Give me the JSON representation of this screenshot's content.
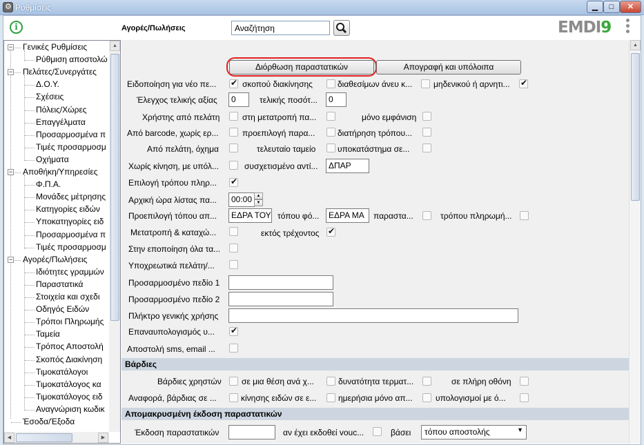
{
  "window": {
    "title": "Ρυθμίσεις",
    "min": "▁",
    "max": "□",
    "close": "✕"
  },
  "toolbar": {
    "section_title": "Αγορές/Πωλήσεις",
    "search_value": "Αναζήτηση",
    "logo_main": "EMDI",
    "logo_accent": "9",
    "info_glyph": "i"
  },
  "tree": {
    "items": [
      {
        "label": "Γενικές Ρυθμίσεις"
      },
      {
        "label": "Ρύθμιση αποστολώ"
      },
      {
        "label": "Πελάτες/Συνεργάτες"
      },
      {
        "label": "Δ.Ο.Υ."
      },
      {
        "label": "Σχέσεις"
      },
      {
        "label": "Πόλεις/Χώρες"
      },
      {
        "label": "Επαγγέλματα"
      },
      {
        "label": "Προσαρμοσμένα π"
      },
      {
        "label": "Τιμές προσαρμοσμ"
      },
      {
        "label": "Οχήματα"
      },
      {
        "label": "Αποθήκη/Υπηρεσίες"
      },
      {
        "label": "Φ.Π.Α."
      },
      {
        "label": "Μονάδες μέτρησης"
      },
      {
        "label": "Κατηγορίες ειδών"
      },
      {
        "label": "Υποκατηγορίες ειδ"
      },
      {
        "label": "Προσαρμοσμένα π"
      },
      {
        "label": "Τιμές προσαρμοσμ"
      },
      {
        "label": "Αγορές/Πωλήσεις"
      },
      {
        "label": "Ιδιότητες γραμμών"
      },
      {
        "label": "Παραστατικά"
      },
      {
        "label": "Στοιχεία και σχεδι"
      },
      {
        "label": "Οδηγός Ειδών"
      },
      {
        "label": "Τρόποι Πληρωμής"
      },
      {
        "label": "Ταμεία"
      },
      {
        "label": "Τρόπος Αποστολή"
      },
      {
        "label": "Σκοπός Διακίνηση"
      },
      {
        "label": "Τιμοκατάλογοι"
      },
      {
        "label": "Τιμοκατάλογος κα"
      },
      {
        "label": "Τιμοκατάλογος ειδ"
      },
      {
        "label": "Αναγνώριση κωδικ"
      },
      {
        "label": "Έσοδα/Έξοδα"
      }
    ]
  },
  "buttons": {
    "fix_docs": "Διόρθωση παραστατικών",
    "inventory": "Απογραφή και υπόλοιπα"
  },
  "form": {
    "r1": {
      "a": "Ειδοποίηση για νέο πε...",
      "b": "σκοπού διακίνησης",
      "c": "διαθεσίμων άνευ κ...",
      "d": "μηδενικού ή αρνητι..."
    },
    "r2": {
      "a": "Έλεγχος τελικής αξίας",
      "a_val": "0",
      "b": "τελικής ποσότ...",
      "b_val": "0"
    },
    "r3": {
      "a": "Χρήστης από πελάτη",
      "b": "στη μετατροπή πα...",
      "c": "μόνο εμφάνιση"
    },
    "r4": {
      "a": "Από barcode, χωρίς ερ...",
      "b": "προεπιλογή παρα...",
      "c": "διατήρηση τρόπου..."
    },
    "r5": {
      "a": "Από πελάτη, όχημα",
      "b": "τελευταίο ταμείο",
      "c": "υποκατάστημα σε..."
    },
    "r6": {
      "a": "Χωρίς κίνηση, με υπόλ...",
      "b": "συσχετισμένο αντί...",
      "b_val": "ΔΠΑΡ"
    },
    "r7": {
      "a": "Επιλογή τρόπου πληρ..."
    },
    "r8": {
      "a": "Αρχική ώρα λίστας πα...",
      "time": "00:00"
    },
    "r9": {
      "a": "Προεπιλογή τόπου απ...",
      "val1": "ΕΔΡΑ ΤΟΥ",
      "b": "τόπου φό...",
      "val2": "ΕΔΡΑ ΜΑ",
      "c": "παραστα...",
      "d": "τρόπου πληρωμή..."
    },
    "r10": {
      "a": "Μετατροπή & καταχώ...",
      "b": "εκτός τρέχοντος"
    },
    "r11": {
      "a": "Στην εποποίηση όλα τα..."
    },
    "r12": {
      "a": "Υποχρεωτικά πελάτη/..."
    },
    "r13": {
      "a": "Προσαρμοσμένο πεδίο 1",
      "val": ""
    },
    "r14": {
      "a": "Προσαρμοσμένο πεδίο 2",
      "val": ""
    },
    "r15": {
      "a": "Πλήκτρο γενικής χρήσης",
      "val": ""
    },
    "r16": {
      "a": "Επαναυπολογισμός υ..."
    },
    "r17": {
      "a": "Αποστολή sms, email ..."
    },
    "shifts_header": "Βάρδιες",
    "s1": {
      "a": "Βάρδιες χρηστών",
      "b": "σε μια θέση ανά χ...",
      "c": "δυνατότητα τερματ...",
      "d": "σε πλήρη οθόνη"
    },
    "s2": {
      "a": "Αναφορά, βάρδιας σε ...",
      "b": "κίνησης ειδών σε ε...",
      "c": "ημερήσια μόνο απ...",
      "d": "υπολογισμοί με ό..."
    },
    "remote_header": "Απομακρυσμένη έκδοση παραστατικών",
    "rm1": {
      "a": "Έκδοση παραστατικών",
      "val": "",
      "b": "αν έχει εκδοθεί vouc...",
      "c": "βάσει",
      "select": "τόπου αποστολής"
    }
  }
}
